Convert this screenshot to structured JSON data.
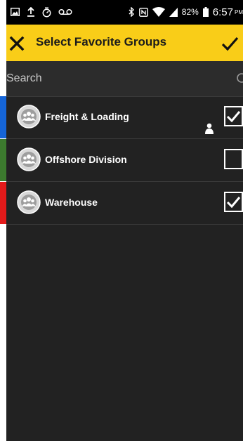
{
  "status_bar": {
    "left_icons": [
      "image-icon",
      "upload-icon",
      "timer-icon",
      "voicemail-icon"
    ],
    "right_icons": [
      "bluetooth-icon",
      "nfc-icon",
      "wifi-icon",
      "signal-icon",
      "battery-icon"
    ],
    "battery": "82%",
    "time": "6:57",
    "ampm": "PM"
  },
  "app_bar": {
    "title": "Select Favorite Groups",
    "background": "#f9cd18"
  },
  "search": {
    "placeholder": "Search"
  },
  "groups": [
    {
      "name": "Freight & Loading",
      "color": "#1565d8",
      "checked": true,
      "has_person_icon": true
    },
    {
      "name": "Offshore Division",
      "color": "#3c7a2e",
      "checked": false,
      "has_person_icon": false
    },
    {
      "name": "Warehouse",
      "color": "#e31a1a",
      "checked": true,
      "has_person_icon": false
    }
  ]
}
